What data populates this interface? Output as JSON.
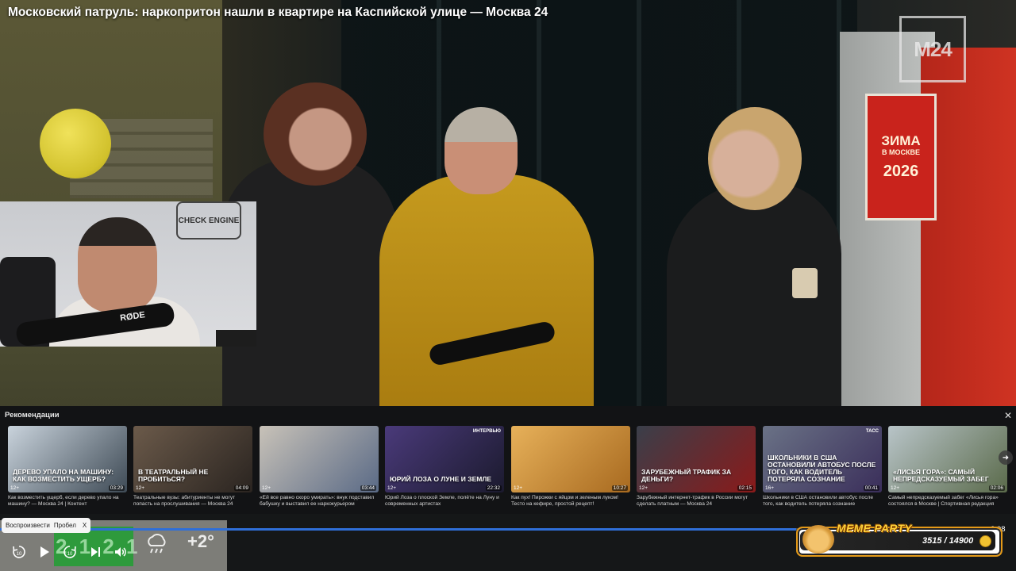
{
  "video": {
    "title": "Московский патруль: наркопритон нашли в квартире на Каспийской улице — Москва 24",
    "channel_logo": "M24",
    "poster": {
      "line1": "ЗИМА",
      "line2": "В МОСКВЕ",
      "year": "2026"
    }
  },
  "webcam": {
    "mic_brand": "RØDE",
    "sign_text": "CHECK ENGINE"
  },
  "recommendations": {
    "heading": "Рекомендации",
    "close_icon": "close-icon",
    "items": [
      {
        "caption": "Дерево упало на машину: как возместить ущерб?",
        "age": "12+",
        "duration": "03:29",
        "description": "Как возместить ущерб, если дерево упало на машину? — Москва 24 | Контент",
        "color_a": "#c9d3dc",
        "color_b": "#3e4a55"
      },
      {
        "caption": "В театральный не пробиться?",
        "age": "12+",
        "duration": "04:09",
        "description": "Театральные вузы: абитуриенты не могут попасть на прослушивания — Москва 24",
        "color_a": "#6b5a4a",
        "color_b": "#2a2420"
      },
      {
        "caption": "",
        "age": "12+",
        "duration": "03:44",
        "description": "«Ей все равно скоро умирать»: внук подставил бабушку и выставил ее наркокурьером",
        "color_a": "#c8c2b8",
        "color_b": "#5a6a86"
      },
      {
        "caption": "Юрий Лоза о Луне и Земле",
        "age": "12+",
        "duration": "22:32",
        "description": "Юрий Лоза о плоской Земле, полёте на Луну и современных артистах",
        "color_a": "#4a3a7a",
        "color_b": "#1b1a2e",
        "tag": "ИНТЕРВЬЮ"
      },
      {
        "caption": "",
        "age": "12+",
        "duration": "10:27",
        "description": "Как пух! Пирожки с яйцом и зеленым луком! Тесто на кефире, простой рецепт!",
        "color_a": "#e7b15a",
        "color_b": "#a86a20"
      },
      {
        "caption": "Зарубежный трафик за деньги?",
        "age": "12+",
        "duration": "02:15",
        "description": "Зарубежный интернет-трафик в России могут сделать платным — Москва 24",
        "color_a": "#3a3f4a",
        "color_b": "#8a1a1a"
      },
      {
        "caption": "Школьники в США остановили автобус после того, как водитель потеряла сознание",
        "age": "16+",
        "duration": "00:41",
        "description": "Школьники в США остановили автобус после того, как водитель потеряла сознание",
        "color_a": "#6a7286",
        "color_b": "#3a2e5a",
        "tag": "ТАСС"
      },
      {
        "caption": "«Лисья гора»: самый непредсказуемый забег",
        "age": "12+",
        "duration": "02:06",
        "description": "Самый непредсказуемый забег «Лисья гора» состоялся в Москве | Спортивная редакция",
        "color_a": "#b8c4c8",
        "color_b": "#5a6a4a"
      }
    ],
    "next_icon": "chevron-right-icon"
  },
  "player": {
    "progress_fraction": 0.81,
    "time_right": "2:08",
    "tooltip": {
      "label": "Воспроизвести",
      "key": "Пробел",
      "close": "X"
    },
    "controls": {
      "rewind_label": "10",
      "forward_label": "10",
      "rewind_icon": "rewind-10-icon",
      "play_icon": "play-icon",
      "forward_icon": "forward-10-icon",
      "next_icon": "skip-next-icon",
      "volume_icon": "volume-icon"
    }
  },
  "weather": {
    "temperature": "+2°",
    "digits": "2 1  2 1",
    "icon": "cloud-rain-icon"
  },
  "meme_party": {
    "title": "MEME PARTY",
    "score": "3515 / 14900"
  },
  "colors": {
    "accent_blue": "#2f6fd8",
    "meme_gold": "#ffd23a",
    "m24_red": "#c9231c"
  }
}
